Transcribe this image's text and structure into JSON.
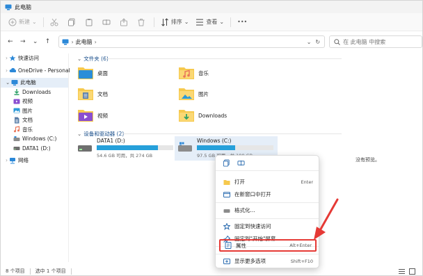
{
  "window": {
    "title": "此电脑"
  },
  "toolbar": {
    "new_label": "新建",
    "sort_label": "排序",
    "view_label": "查看",
    "more_label": "•••"
  },
  "address": {
    "path": "此电脑",
    "search_placeholder": "在 此电脑 中搜索"
  },
  "sidebar": {
    "items": [
      {
        "label": "快速访问",
        "icon": "star-icon",
        "selected": false
      },
      {
        "label": "OneDrive - Personal",
        "icon": "cloud-icon",
        "selected": false
      },
      {
        "label": "此电脑",
        "icon": "pc-icon",
        "selected": true
      },
      {
        "label": "Downloads",
        "icon": "download-icon",
        "selected": false
      },
      {
        "label": "视频",
        "icon": "video-icon",
        "selected": false
      },
      {
        "label": "图片",
        "icon": "picture-icon",
        "selected": false
      },
      {
        "label": "文档",
        "icon": "document-icon",
        "selected": false
      },
      {
        "label": "音乐",
        "icon": "music-icon",
        "selected": false
      },
      {
        "label": "Windows (C:)",
        "icon": "drive-icon",
        "selected": false
      },
      {
        "label": "DATA1 (D:)",
        "icon": "drive-icon",
        "selected": false
      },
      {
        "label": "网络",
        "icon": "network-icon",
        "selected": false
      }
    ]
  },
  "folders_group": {
    "label": "文件夹 (6)"
  },
  "folders": [
    {
      "name": "桌面",
      "icon": "desktop-folder-icon",
      "color": "#2a8ed8"
    },
    {
      "name": "音乐",
      "icon": "music-folder-icon",
      "color": "#e9775a"
    },
    {
      "name": "文档",
      "icon": "documents-folder-icon",
      "color": "#5c7fa8"
    },
    {
      "name": "图片",
      "icon": "pictures-folder-icon",
      "color": "#2c9ad8"
    },
    {
      "name": "视频",
      "icon": "videos-folder-icon",
      "color": "#8a4fd1"
    },
    {
      "name": "Downloads",
      "icon": "downloads-folder-icon",
      "color": "#2ea068"
    }
  ],
  "devices_group": {
    "label": "设备和驱动器 (2)"
  },
  "drives": [
    {
      "name": "DATA1 (D:)",
      "space": "54.6 GB 可用，共 274 GB",
      "used_fraction": 0.8
    },
    {
      "name": "Windows (C:)",
      "space": "97.5 GB 可用，共 199 GB",
      "used_fraction": 0.5
    }
  ],
  "preview": {
    "text": "没有预览。"
  },
  "status": {
    "count": "8 个项目",
    "selected": "选中 1 个项目"
  },
  "context_menu": {
    "items": [
      {
        "label": "打开",
        "shortcut": "Enter",
        "icon": "open-folder-icon"
      },
      {
        "label": "在新窗口中打开",
        "shortcut": "",
        "icon": "new-window-icon"
      },
      {
        "label": "格式化...",
        "shortcut": "",
        "icon": "format-icon"
      },
      {
        "label": "固定到快速访问",
        "shortcut": "",
        "icon": "pin-star-icon"
      },
      {
        "label": "固定到\"开始\"屏幕",
        "shortcut": "",
        "icon": "pin-icon"
      },
      {
        "label": "属性",
        "shortcut": "Alt+Enter",
        "icon": "properties-icon"
      },
      {
        "label": "显示更多选项",
        "shortcut": "Shift+F10",
        "icon": "more-options-icon"
      }
    ]
  },
  "colors": {
    "accent": "#26a0da",
    "highlight": "#e53935",
    "selected_bg": "#e5eef8"
  }
}
